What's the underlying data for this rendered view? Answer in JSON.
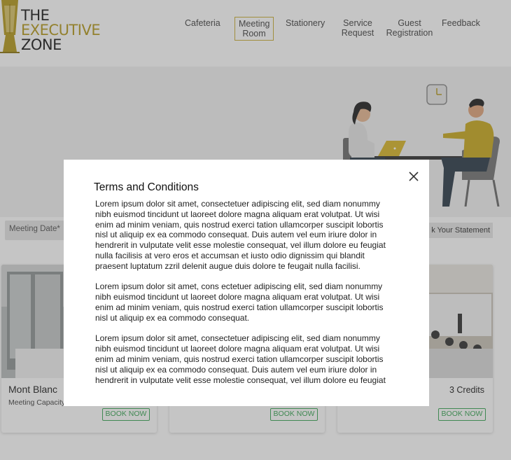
{
  "logo": {
    "line1": "THE",
    "line2": "EXECUTIVE",
    "line3": "ZONE"
  },
  "nav": {
    "items": [
      {
        "label": "Cafeteria",
        "active": false
      },
      {
        "label": "Meeting\nRoom",
        "active": true
      },
      {
        "label": "Stationery",
        "active": false
      },
      {
        "label": "Service\nRequest",
        "active": false
      },
      {
        "label": "Guest\nRegistration",
        "active": false
      },
      {
        "label": "Feedback",
        "active": false
      }
    ]
  },
  "filters": {
    "meeting_date": "Meeting Date*",
    "statement_button": "k Your Statement"
  },
  "cards": [
    {
      "title": "Mont Blanc",
      "capacity": "Meeting Capacity",
      "credits": "",
      "button": "BOOK NOW"
    },
    {
      "title": "",
      "capacity": "",
      "credits": "",
      "button": "BOOK NOW"
    },
    {
      "title": "",
      "capacity": "",
      "credits": "3 Credits",
      "button": "BOOK NOW"
    }
  ],
  "modal": {
    "title": "Terms and Conditions",
    "paragraphs": [
      "Lorem ipsum dolor sit amet, consectetuer adipiscing elit, sed diam nonummy nibh euismod tincidunt ut laoreet dolore magna aliquam erat volutpat. Ut wisi enim ad minim veniam, quis nostrud exerci tation ullamcorper suscipit lobortis nisl ut aliquip ex ea commodo consequat. Duis autem vel eum iriure dolor in hendrerit in vulputate velit esse molestie consequat, vel illum dolore eu feugiat nulla facilisis at vero eros et accumsan et iusto odio dignissim qui blandit praesent luptatum zzril delenit augue duis dolore te feugait nulla facilisi.",
      "Lorem ipsum dolor sit amet, cons ectetuer adipiscing elit, sed diam nonummy nibh euismod tincidunt ut laoreet dolore magna aliquam erat volutpat. Ut wisi enim ad minim veniam, quis nostrud exerci tation ullamcorper suscipit lobortis nisl ut aliquip ex ea commodo consequat.",
      "Lorem ipsum dolor sit amet, consectetuer adipiscing elit, sed diam nonummy nibh euismod tincidunt ut laoreet dolore magna aliquam erat volutpat. Ut wisi enim ad minim veniam, quis nostrud exerci tation ullamcorper suscipit lobortis nisl ut aliquip ex ea commodo consequat. Duis autem vel eum iriure dolor in hendrerit in vulputate velit esse molestie consequat, vel illum dolore eu feugiat"
    ]
  },
  "colors": {
    "brand_gold": "#b59a1e",
    "book_green": "#3aa655",
    "overlay": "#505050"
  },
  "icons": {
    "close": "close-icon",
    "logo": "building-logo-icon",
    "clock": "clock-icon"
  }
}
